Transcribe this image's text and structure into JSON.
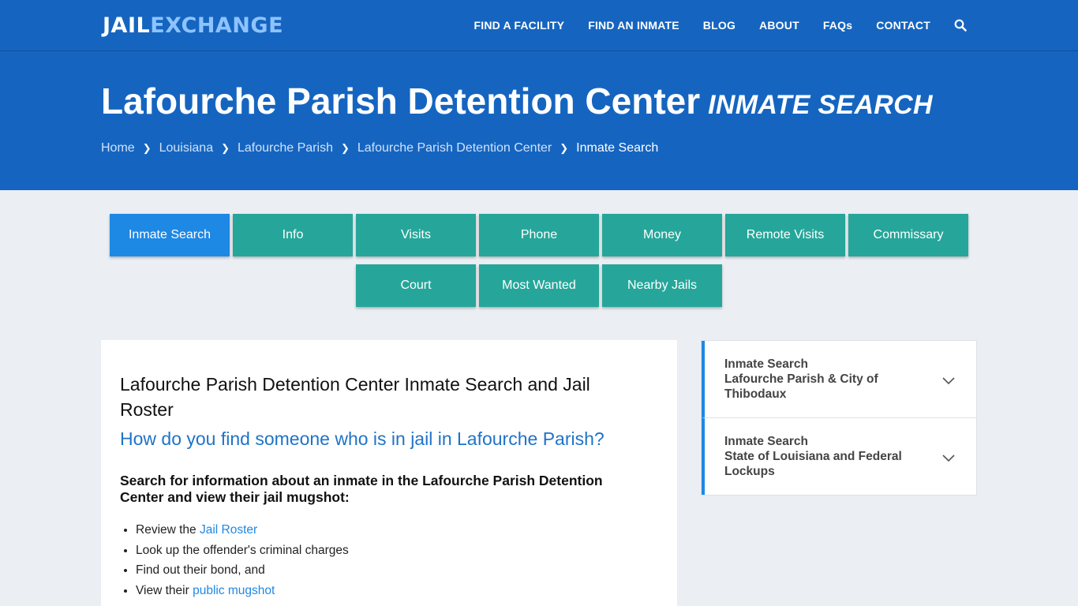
{
  "brand": {
    "part1": "JAIL",
    "part2": "EXCHANGE"
  },
  "nav": {
    "items": [
      "FIND A FACILITY",
      "FIND AN INMATE",
      "BLOG",
      "ABOUT",
      "FAQs",
      "CONTACT"
    ],
    "search_icon": "search-icon"
  },
  "hero": {
    "title": "Lafourche Parish Detention Center",
    "subtitle": "INMATE SEARCH",
    "breadcrumb": [
      "Home",
      "Louisiana",
      "Lafourche Parish",
      "Lafourche Parish Detention Center"
    ],
    "breadcrumb_current": "Inmate Search"
  },
  "tabs": {
    "row1": [
      "Inmate Search",
      "Info",
      "Visits",
      "Phone",
      "Money",
      "Remote Visits",
      "Commissary"
    ],
    "row2": [
      "Court",
      "Most Wanted",
      "Nearby Jails"
    ],
    "active": "Inmate Search"
  },
  "main": {
    "heading": "Lafourche Parish Detention Center Inmate Search and Jail Roster",
    "question": "How do you find someone who is in jail in Lafourche Parish?",
    "lead": "Search for information about an inmate in the Lafourche Parish Detention Center and view their jail mugshot:",
    "list": [
      {
        "prefix": "Review the ",
        "link": "Jail Roster"
      },
      {
        "prefix": "Look up the offender's criminal charges",
        "link": ""
      },
      {
        "prefix": "Find out their bond, and",
        "link": ""
      },
      {
        "prefix": "View their ",
        "link": "public mugshot"
      }
    ]
  },
  "sidebar": {
    "items": [
      {
        "line1": "Inmate Search",
        "line2": "Lafourche Parish & City of Thibodaux"
      },
      {
        "line1": "Inmate Search",
        "line2": "State of Louisiana and Federal Lockups"
      }
    ]
  },
  "colors": {
    "primary": "#1565c0",
    "accent_blue": "#1e88e5",
    "teal": "#26a69a",
    "logo_light": "#8ec3ff"
  }
}
